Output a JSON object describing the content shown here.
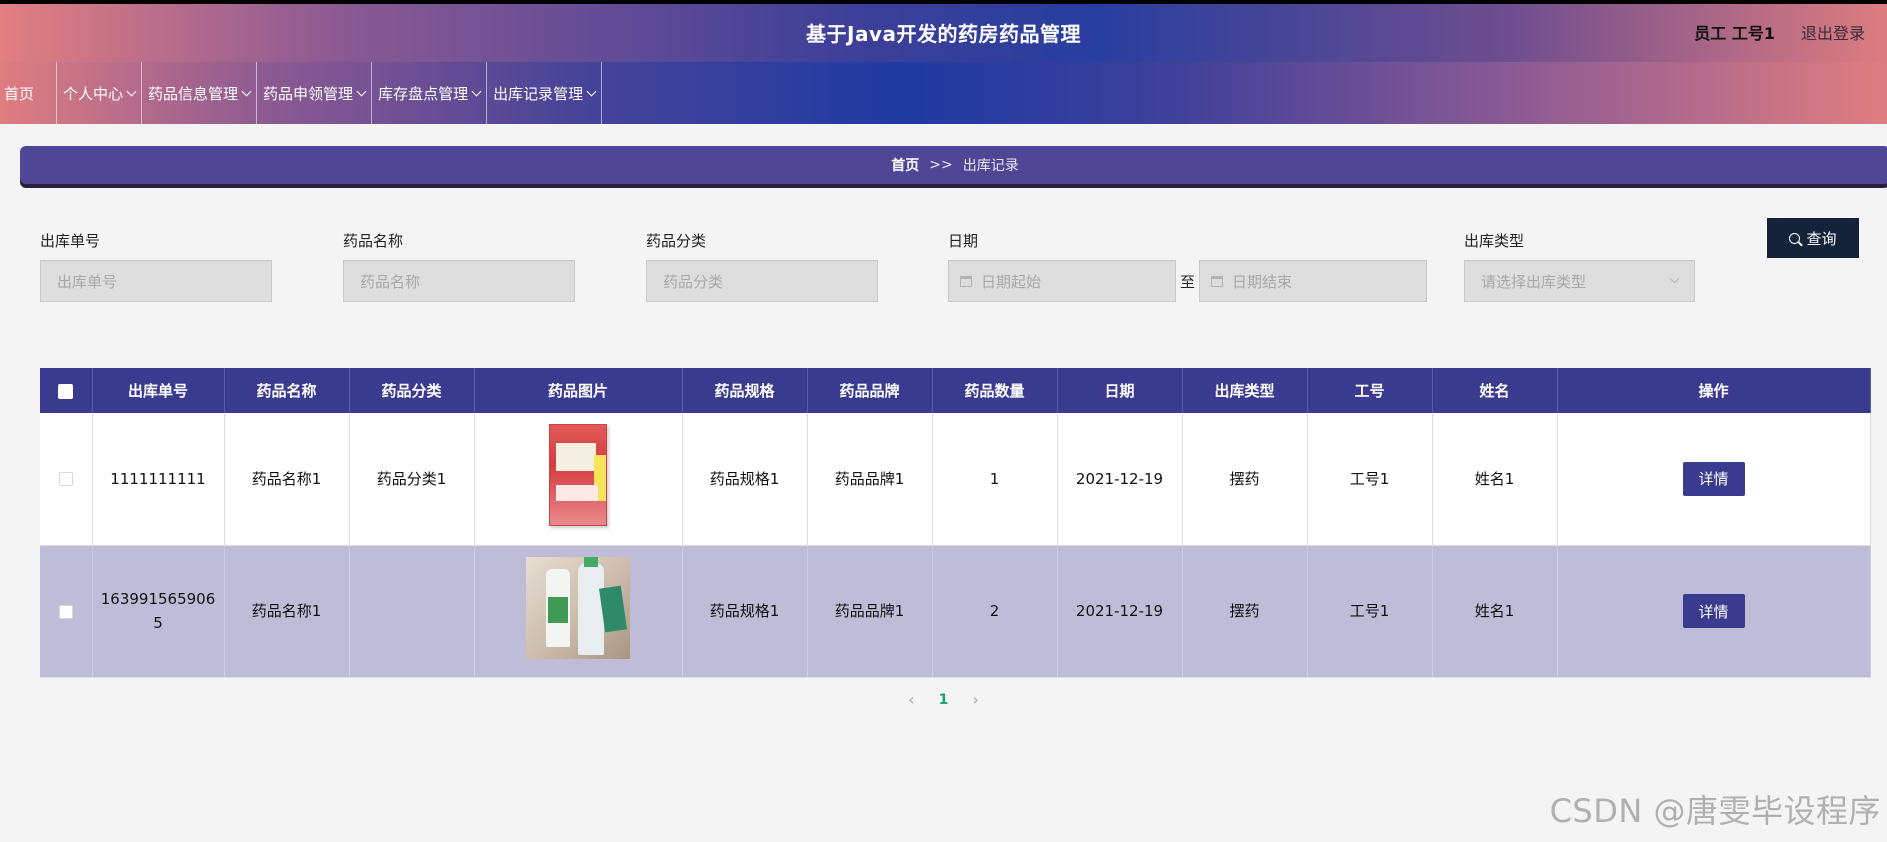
{
  "header": {
    "title": "基于Java开发的药房药品管理",
    "user_label": "员工 工号1",
    "logout": "退出登录"
  },
  "nav": {
    "home": "首页",
    "items": [
      "个人中心",
      "药品信息管理",
      "药品申领管理",
      "库存盘点管理",
      "出库记录管理"
    ]
  },
  "breadcrumb": {
    "home": "首页",
    "separator": ">>",
    "current": "出库记录"
  },
  "filters": {
    "order_no": {
      "label": "出库单号",
      "placeholder": "出库单号"
    },
    "drug_name": {
      "label": "药品名称",
      "placeholder": "药品名称"
    },
    "drug_category": {
      "label": "药品分类",
      "placeholder": "药品分类"
    },
    "date": {
      "label": "日期",
      "start_placeholder": "日期起始",
      "to": "至",
      "end_placeholder": "日期结束"
    },
    "outbound_type": {
      "label": "出库类型",
      "placeholder": "请选择出库类型"
    },
    "search_label": "查询"
  },
  "table": {
    "columns": [
      "出库单号",
      "药品名称",
      "药品分类",
      "药品图片",
      "药品规格",
      "药品品牌",
      "药品数量",
      "日期",
      "出库类型",
      "工号",
      "姓名",
      "操作"
    ],
    "rows": [
      {
        "order_no": "1111111111",
        "drug_name": "药品名称1",
        "category": "药品分类1",
        "spec": "药品规格1",
        "brand": "药品品牌1",
        "qty": "1",
        "date": "2021-12-19",
        "type": "摆药",
        "emp_no": "工号1",
        "name": "姓名1",
        "action": "详情"
      },
      {
        "order_no": "1639915659065",
        "drug_name": "药品名称1",
        "category": "",
        "spec": "药品规格1",
        "brand": "药品品牌1",
        "qty": "2",
        "date": "2021-12-19",
        "type": "摆药",
        "emp_no": "工号1",
        "name": "姓名1",
        "action": "详情"
      }
    ]
  },
  "pagination": {
    "prev": "‹",
    "current": "1",
    "next": "›"
  },
  "watermark": "CSDN @唐雯毕设程序",
  "colors": {
    "primary": "#3a3b8f",
    "search_button": "#14233a",
    "row_alt": "#bebcd6",
    "active_page": "#1aa37a"
  }
}
